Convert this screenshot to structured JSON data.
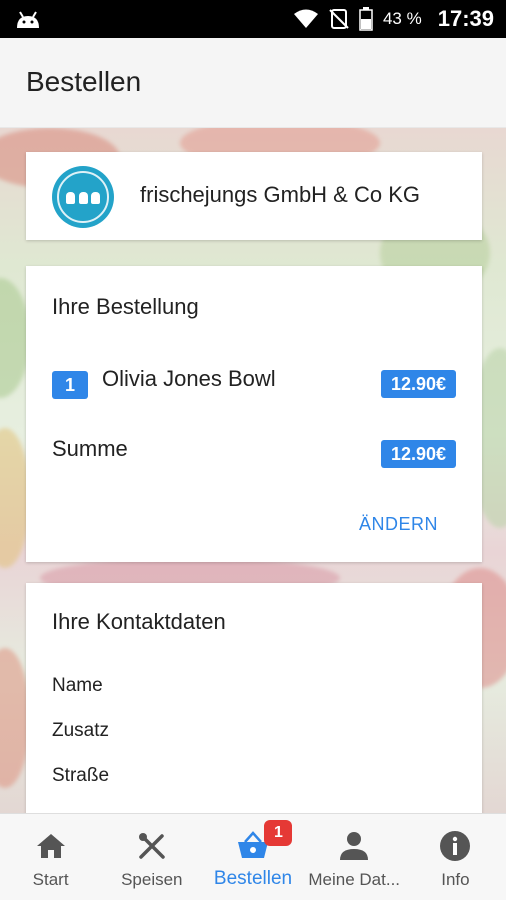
{
  "status_bar": {
    "battery_percent": "43 %",
    "time": "17:39"
  },
  "header": {
    "title": "Bestellen"
  },
  "shop": {
    "name": "frischejungs GmbH & Co KG",
    "logo_icon": "frischejungs-logo"
  },
  "order": {
    "heading": "Ihre Bestellung",
    "items": [
      {
        "quantity": "1",
        "name": "Olivia Jones Bowl",
        "price": "12.90€"
      }
    ],
    "sum_label": "Summe",
    "sum_price": "12.90€",
    "change_label": "ÄNDERN"
  },
  "contact": {
    "heading": "Ihre Kontaktdaten",
    "fields": [
      "Name",
      "Zusatz",
      "Straße"
    ]
  },
  "bottom_nav": {
    "items": [
      {
        "label": "Start",
        "icon": "home-icon"
      },
      {
        "label": "Speisen",
        "icon": "cutlery-icon"
      },
      {
        "label": "Bestellen",
        "icon": "basket-icon",
        "badge": "1"
      },
      {
        "label": "Meine Dat...",
        "icon": "person-icon"
      },
      {
        "label": "Info",
        "icon": "info-icon"
      }
    ]
  },
  "colors": {
    "accent": "#2f86e8",
    "badge": "#e53935",
    "logo": "#23a3c9"
  }
}
